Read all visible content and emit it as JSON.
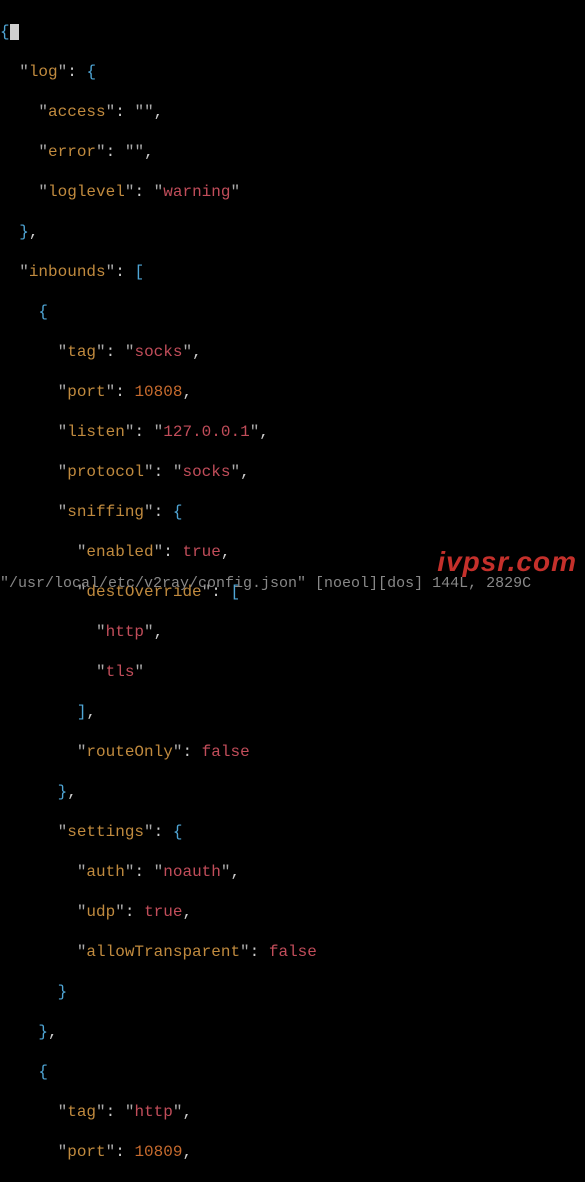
{
  "json": {
    "log_key": "log",
    "access_key": "access",
    "access_val": "",
    "error_key": "error",
    "error_val": "",
    "loglevel_key": "loglevel",
    "loglevel_val": "warning",
    "inbounds_key": "inbounds",
    "tag_key": "tag",
    "tag1_val": "socks",
    "port_key": "port",
    "port1_val": "10808",
    "listen_key": "listen",
    "listen_val": "127.0.0.1",
    "protocol_key": "protocol",
    "protocol_val": "socks",
    "sniffing_key": "sniffing",
    "enabled_key": "enabled",
    "enabled_val": "true",
    "destOverride_key": "destOverride",
    "do_http": "http",
    "do_tls": "tls",
    "routeOnly_key": "routeOnly",
    "routeOnly_val": "false",
    "settings_key": "settings",
    "auth_key": "auth",
    "auth_val": "noauth",
    "udp_key": "udp",
    "udp_val": "true",
    "allowTransparent_key": "allowTransparent",
    "allowTransparent_val": "false",
    "tag2_val": "http",
    "port2_val": "10809"
  },
  "status_line": "\"/usr/local/etc/v2ray/config.json\" [noeol][dos] 144L, 2829C",
  "watermark": "ivpsr.com",
  "punct": {
    "lbrace": "{",
    "rbrace": "}",
    "lbracket": "[",
    "rbracket": "]",
    "q": "\"",
    "colon": ":",
    "comma": ",",
    "sp": " "
  }
}
